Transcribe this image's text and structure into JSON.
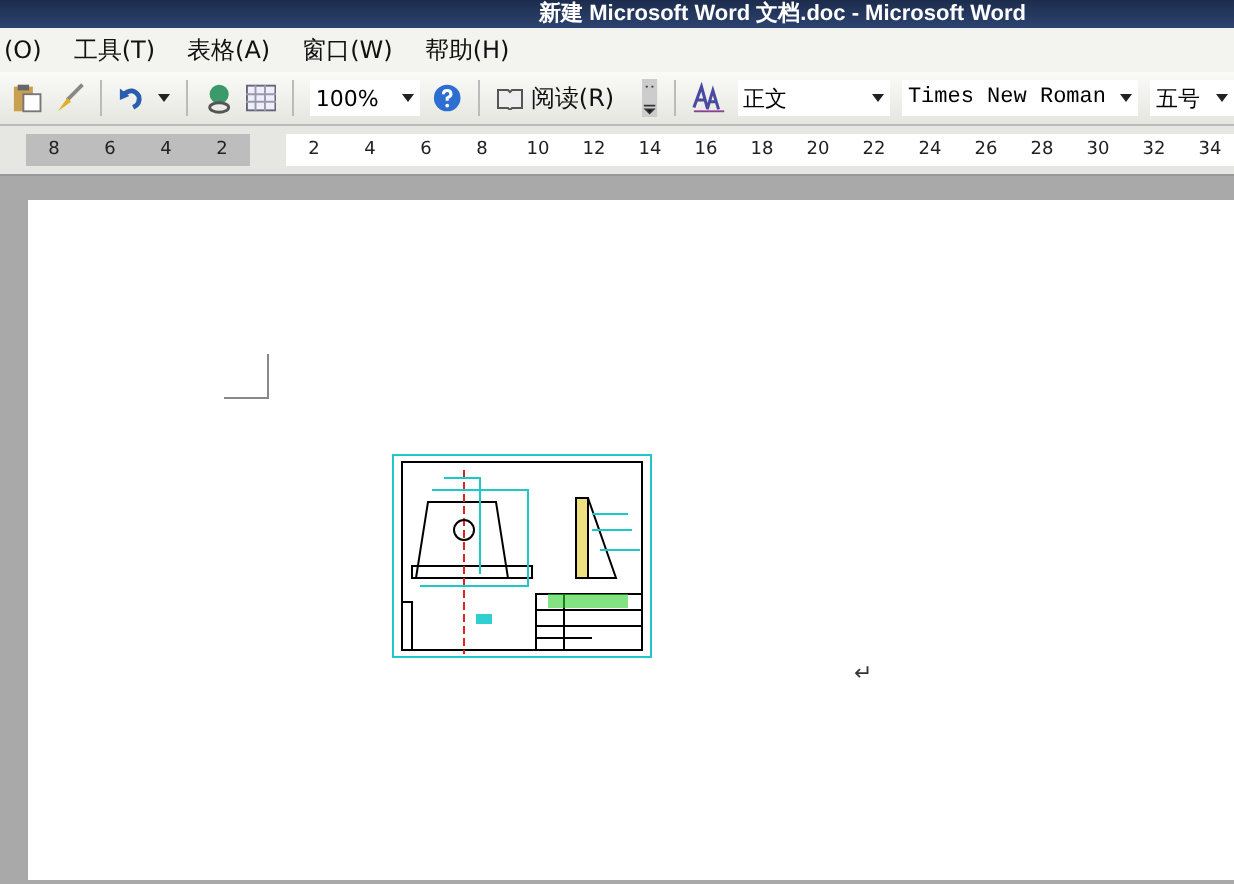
{
  "window": {
    "title": "新建 Microsoft Word 文档.doc - Microsoft Word"
  },
  "menu": [
    "(O)",
    "工具(T)",
    "表格(A)",
    "窗口(W)",
    "帮助(H)"
  ],
  "toolbar": {
    "zoom": "100%",
    "read_button": "阅读(R)",
    "style": "正文",
    "font": "Times New Roman",
    "size": "五号"
  },
  "ruler": {
    "left_ticks": [
      "8",
      "6",
      "4",
      "2"
    ],
    "right_ticks": [
      "2",
      "4",
      "6",
      "8",
      "10",
      "12",
      "14",
      "16",
      "18",
      "20",
      "22",
      "24",
      "26",
      "28",
      "30",
      "32",
      "34"
    ]
  },
  "document": {
    "paragraph_mark": "↵"
  }
}
